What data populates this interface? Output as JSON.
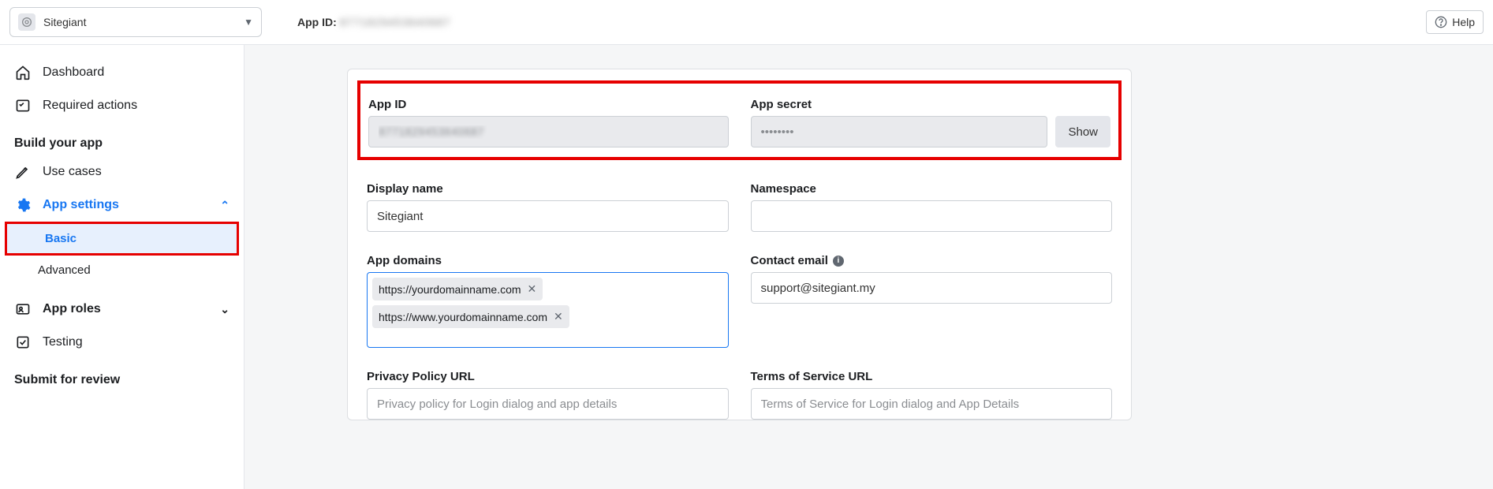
{
  "topbar": {
    "app_name": "Sitegiant",
    "appid_label": "App ID:",
    "appid_value": "8771829453640687",
    "help_label": "Help"
  },
  "sidebar": {
    "dashboard": "Dashboard",
    "required_actions": "Required actions",
    "section_build": "Build your app",
    "use_cases": "Use cases",
    "app_settings": "App settings",
    "basic": "Basic",
    "advanced": "Advanced",
    "app_roles": "App roles",
    "testing": "Testing",
    "section_submit": "Submit for review"
  },
  "form": {
    "app_id_label": "App ID",
    "app_id_value": "8771829453640687",
    "app_secret_label": "App secret",
    "app_secret_value": "••••••••",
    "show_label": "Show",
    "display_name_label": "Display name",
    "display_name_value": "Sitegiant",
    "namespace_label": "Namespace",
    "namespace_value": "",
    "app_domains_label": "App domains",
    "domains": [
      "https://yourdomainname.com",
      "https://www.yourdomainname.com"
    ],
    "contact_email_label": "Contact email",
    "contact_email_value": "support@sitegiant.my",
    "privacy_label": "Privacy Policy URL",
    "privacy_placeholder": "Privacy policy for Login dialog and app details",
    "tos_label": "Terms of Service URL",
    "tos_placeholder": "Terms of Service for Login dialog and App Details"
  }
}
